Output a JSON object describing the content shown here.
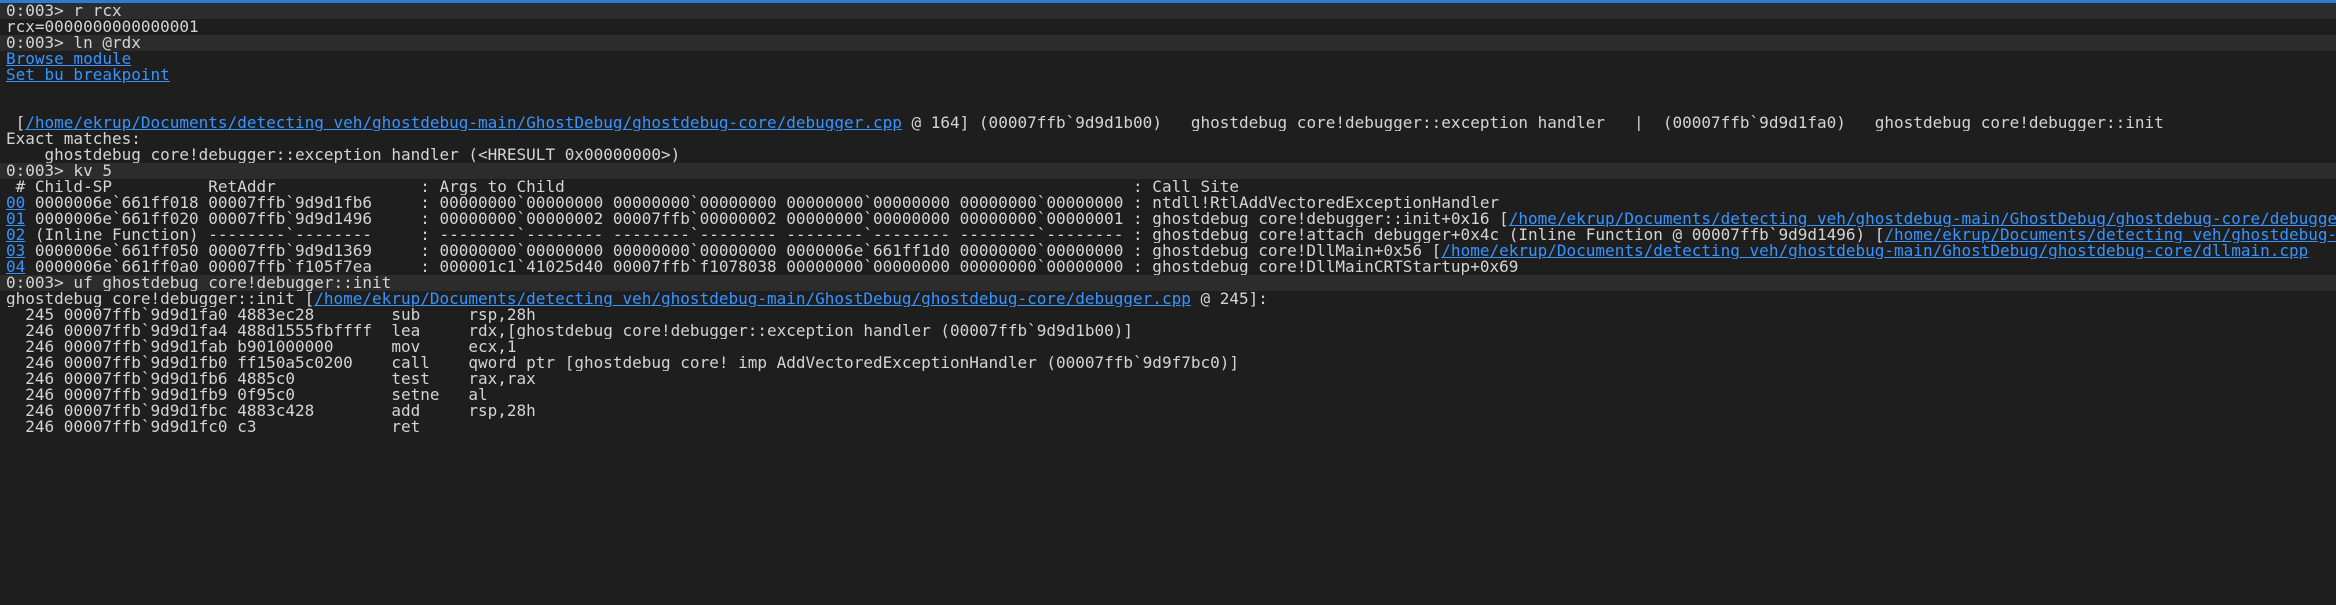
{
  "colors": {
    "accent": "#2f7bd4",
    "link": "#3794ff",
    "background": "#1e1e1e",
    "command_bg": "#2c2c2c",
    "text": "#d4d4d4"
  },
  "lines": {
    "l1": "0:003> r rcx",
    "l2": "rcx=0000000000000001",
    "l3": "0:003> ln @rdx",
    "l4_link": "Browse module",
    "l5_link": "Set bu breakpoint",
    "l6_pre": " [",
    "l6_link": "/home/ekrup/Documents/detecting_veh/ghostdebug-main/GhostDebug/ghostdebug-core/debugger.cpp",
    "l6_post": " @ 164] (00007ffb`9d9d1b00)   ghostdebug_core!debugger::exception_handler   |  (00007ffb`9d9d1fa0)   ghostdebug_core!debugger::init",
    "l7": "Exact matches:",
    "l8": "    ghostdebug_core!debugger::exception_handler (<HRESULT 0x00000000>)",
    "l9": "0:003> kv 5",
    "l10": " # Child-SP          RetAddr               : Args to Child                                                           : Call Site",
    "r0_link": "00",
    "r0_text": " 0000006e`661ff018 00007ffb`9d9d1fb6     : 00000000`00000000 00000000`00000000 00000000`00000000 00000000`00000000 : ntdll!RtlAddVectoredExceptionHandler",
    "r1_link": "01",
    "r1_text": " 0000006e`661ff020 00007ffb`9d9d1496     : 00000000`00000002 00007ffb`00000002 00000000`00000000 00000000`00000001 : ghostdebug_core!debugger::init+0x16 [",
    "r1_link2": "/home/ekrup/Documents/detecting_veh/ghostdebug-main/GhostDebug/ghostdebug-core/debugger.cpp",
    "r2_link": "02",
    "r2_text": " (Inline Function) --------`--------     : --------`-------- --------`-------- --------`-------- --------`-------- : ghostdebug_core!attach_debugger+0x4c (Inline Function @ 00007ffb`9d9d1496) [",
    "r2_link2": "/home/ekrup/Documents/detecting_veh/ghostdebug-main/GhostDebug/ghostdebug-core/main.cpp",
    "r3_link": "03",
    "r3_text": " 0000006e`661ff050 00007ffb`9d9d1369     : 00000000`00000000 00000000`00000000 0000006e`661ff1d0 00000000`00000000 : ghostdebug_core!DllMain+0x56 [",
    "r3_link2": "/home/ekrup/Documents/detecting_veh/ghostdebug-main/GhostDebug/ghostdebug-core/dllmain.cpp",
    "r4_link": "04",
    "r4_text": " 0000006e`661ff0a0 00007ffb`f105f7ea     : 000001c1`41025d40 00007ffb`f1078038 00000000`00000000 00000000`00000000 : ghostdebug_core!DllMainCRTStartup+0x69",
    "l16": "0:003> uf ghostdebug_core!debugger::init",
    "l17_pre": "ghostdebug_core!debugger::init [",
    "l17_link": "/home/ekrup/Documents/detecting_veh/ghostdebug-main/GhostDebug/ghostdebug-core/debugger.cpp",
    "l17_post": " @ 245]:",
    "a1": "  245 00007ffb`9d9d1fa0 4883ec28        sub     rsp,28h",
    "a2": "  246 00007ffb`9d9d1fa4 488d1555fbffff  lea     rdx,[ghostdebug_core!debugger::exception_handler (00007ffb`9d9d1b00)]",
    "a3": "  246 00007ffb`9d9d1fab b901000000      mov     ecx,1",
    "a4": "  246 00007ffb`9d9d1fb0 ff150a5c0200    call    qword ptr [ghostdebug_core!_imp_AddVectoredExceptionHandler (00007ffb`9d9f7bc0)]",
    "a5": "  246 00007ffb`9d9d1fb6 4885c0          test    rax,rax",
    "a6": "  246 00007ffb`9d9d1fb9 0f95c0          setne   al",
    "a7": "  246 00007ffb`9d9d1fbc 4883c428        add     rsp,28h",
    "a8": "  246 00007ffb`9d9d1fc0 c3              ret"
  }
}
